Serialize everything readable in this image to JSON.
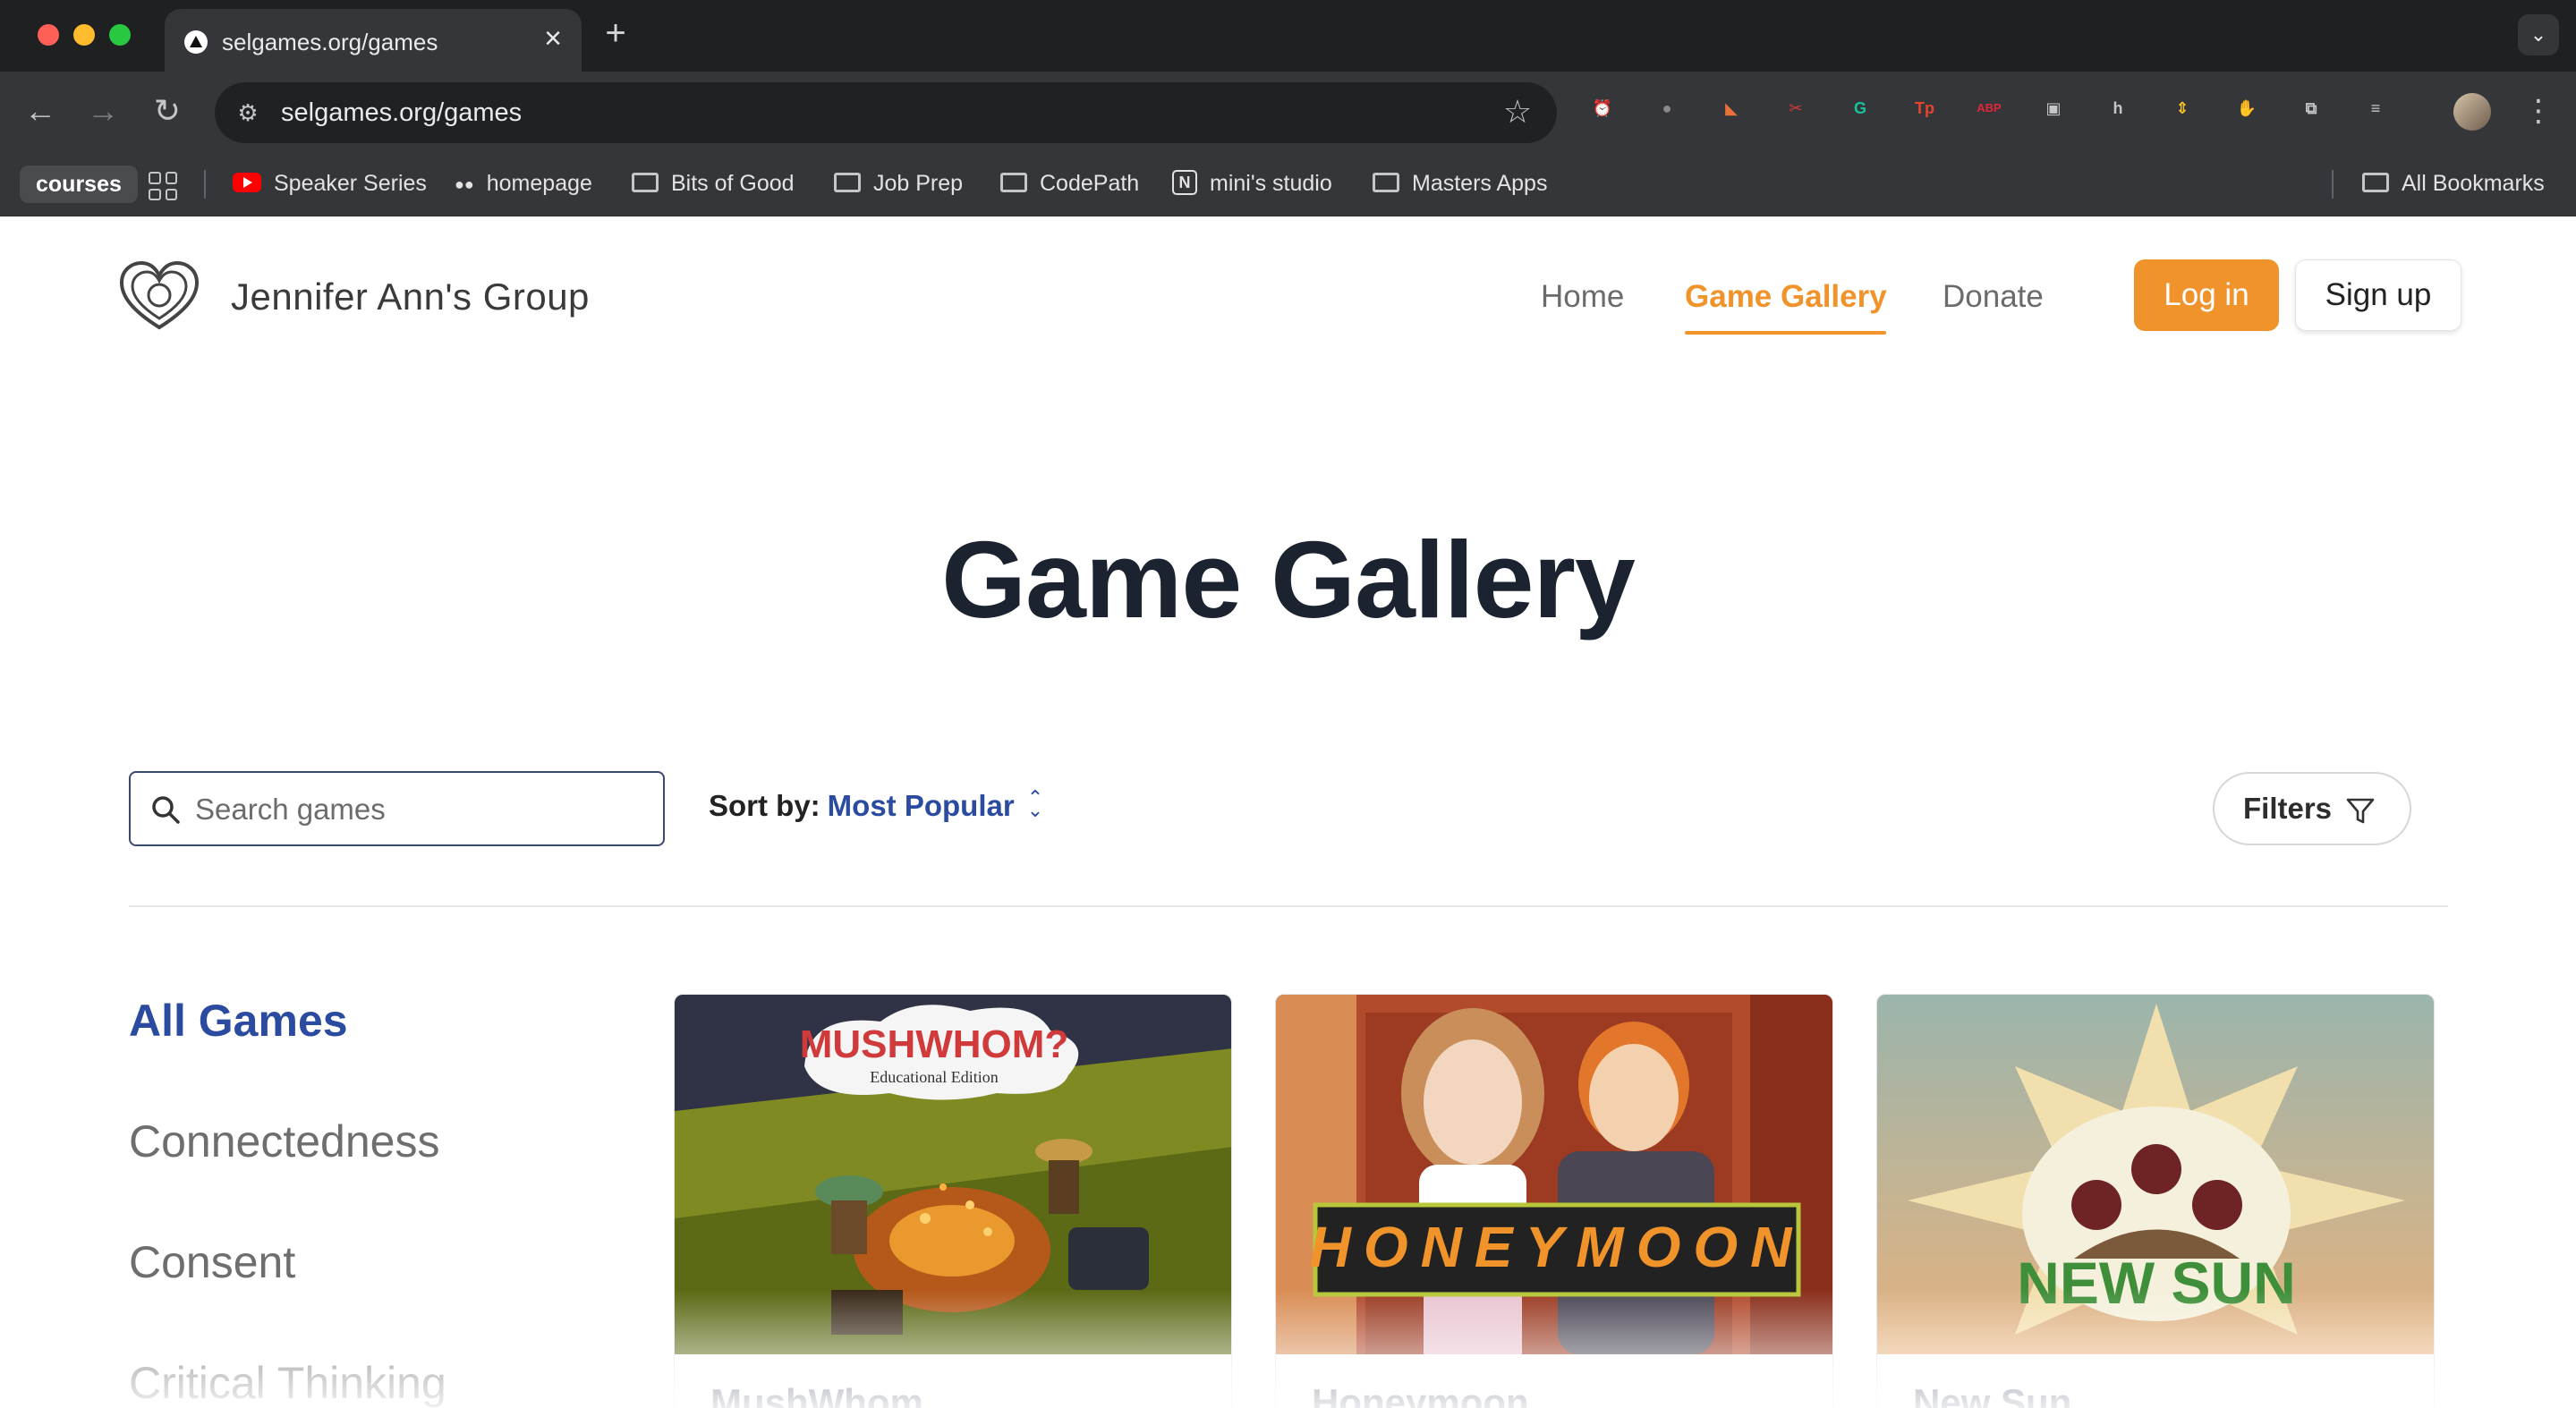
{
  "browser": {
    "tab_title": "selgames.org/games",
    "url": "selgames.org/games",
    "bookmarks": [
      {
        "label": "courses"
      },
      {
        "label": "Speaker Series"
      },
      {
        "label": "homepage"
      },
      {
        "label": "Bits of Good"
      },
      {
        "label": "Job Prep"
      },
      {
        "label": "CodePath"
      },
      {
        "label": "mini's studio"
      },
      {
        "label": "Masters Apps"
      }
    ],
    "all_bookmarks": "All Bookmarks",
    "extensions": [
      {
        "icon": "clock-icon",
        "glyph": "⏰",
        "color": "#4a6fd6"
      },
      {
        "icon": "circle-icon",
        "glyph": "●",
        "color": "#8a8a8a"
      },
      {
        "icon": "flag-icon",
        "glyph": "◣",
        "color": "#e9703a"
      },
      {
        "icon": "scissors-icon",
        "glyph": "✂",
        "color": "#d53a3a"
      },
      {
        "icon": "grammarly-icon",
        "glyph": "G",
        "color": "#15c39a"
      },
      {
        "icon": "tp-icon",
        "glyph": "Tp",
        "color": "#e2462c"
      },
      {
        "icon": "abp-icon",
        "glyph": "ABP",
        "color": "#e0263a"
      },
      {
        "icon": "window-icon",
        "glyph": "▣",
        "color": "#c4c7c5"
      },
      {
        "icon": "h-icon",
        "glyph": "h",
        "color": "#c4c7c5"
      },
      {
        "icon": "arrows-icon",
        "glyph": "⇕",
        "color": "#f5c02a"
      },
      {
        "icon": "hand-icon",
        "glyph": "✋",
        "color": "#e53935"
      },
      {
        "icon": "puzzle-icon",
        "glyph": "⧉",
        "color": "#c4c7c5"
      },
      {
        "icon": "media-icon",
        "glyph": "≡",
        "color": "#c4c7c5"
      }
    ]
  },
  "site": {
    "name": "Jennifer Ann's Group",
    "nav": [
      {
        "label": "Home"
      },
      {
        "label": "Game Gallery"
      },
      {
        "label": "Donate"
      }
    ],
    "login": "Log in",
    "signup": "Sign up",
    "accent_color": "#f0932b",
    "link_color": "#2b4ba0"
  },
  "gallery": {
    "title": "Game Gallery",
    "search_placeholder": "Search games",
    "sort_label": "Sort by:",
    "sort_value": "Most Popular",
    "filters_label": "Filters",
    "categories": [
      {
        "label": "All Games"
      },
      {
        "label": "Connectedness"
      },
      {
        "label": "Consent"
      },
      {
        "label": "Critical Thinking"
      }
    ],
    "games": [
      {
        "title": "MushWhom",
        "art_title": "MUSHWHOM?",
        "art_subtitle": "Educational Edition"
      },
      {
        "title": "Honeymoon",
        "art_title": "HONEYMOON"
      },
      {
        "title": "New Sun",
        "art_title": "NEW SUN"
      }
    ]
  }
}
